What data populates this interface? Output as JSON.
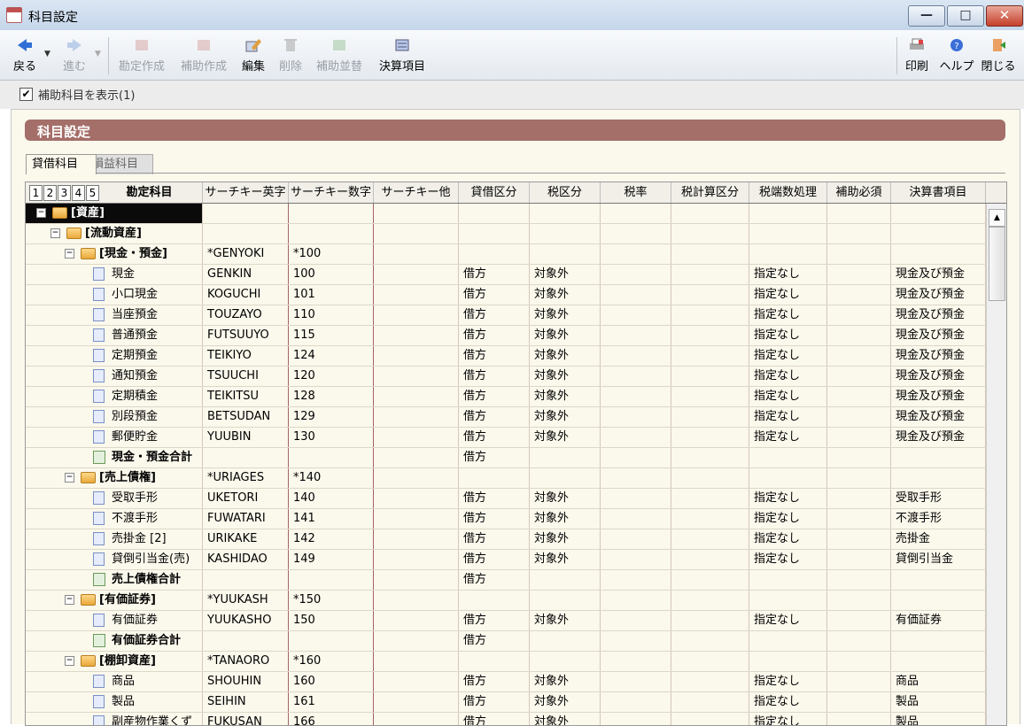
{
  "window": {
    "title": "科目設定"
  },
  "toolbar": {
    "back": "戻る",
    "forward": "進む",
    "create_account": "勘定作成",
    "create_sub": "補助作成",
    "edit": "編集",
    "delete": "削除",
    "sub_order": "補助並替",
    "settlement": "決算項目",
    "print": "印刷",
    "help": "ヘルプ",
    "close": "閉じる"
  },
  "option": {
    "show_sub_label": "補助科目を表示(1)"
  },
  "banner": {
    "title": "科目設定"
  },
  "tabs": [
    {
      "label": "貸借科目"
    },
    {
      "label": "損益科目"
    }
  ],
  "grid": {
    "levels": [
      "1",
      "2",
      "3",
      "4",
      "5"
    ],
    "headers": [
      "勘定科目",
      "サーチキー英字",
      "サーチキー数字",
      "サーチキー他",
      "貸借区分",
      "税区分",
      "税率",
      "税計算区分",
      "税端数処理",
      "補助必須",
      "決算書項目"
    ],
    "rows": [
      {
        "name": "[資産]",
        "type": "folder",
        "level": 0,
        "bold": true,
        "en": "",
        "num": "",
        "dc": "",
        "tax": "",
        "round": "",
        "item": ""
      },
      {
        "name": "[流動資産]",
        "type": "folder",
        "level": 1,
        "bold": true,
        "en": "",
        "num": "",
        "dc": "",
        "tax": "",
        "round": "",
        "item": ""
      },
      {
        "name": "[現金・預金]",
        "type": "folder",
        "level": 2,
        "bold": true,
        "en": "*GENYOKI",
        "num": "*100",
        "dc": "",
        "tax": "",
        "round": "",
        "item": ""
      },
      {
        "name": "現金",
        "type": "doc",
        "level": 3,
        "bold": false,
        "en": "GENKIN",
        "num": "100",
        "dc": "借方",
        "tax": "対象外",
        "round": "指定なし",
        "item": "現金及び預金"
      },
      {
        "name": "小口現金",
        "type": "doc",
        "level": 3,
        "bold": false,
        "en": "KOGUCHI",
        "num": "101",
        "dc": "借方",
        "tax": "対象外",
        "round": "指定なし",
        "item": "現金及び預金"
      },
      {
        "name": "当座預金",
        "type": "doc",
        "level": 3,
        "bold": false,
        "en": "TOUZAYO",
        "num": "110",
        "dc": "借方",
        "tax": "対象外",
        "round": "指定なし",
        "item": "現金及び預金"
      },
      {
        "name": "普通預金",
        "type": "doc",
        "level": 3,
        "bold": false,
        "en": "FUTSUUYO",
        "num": "115",
        "dc": "借方",
        "tax": "対象外",
        "round": "指定なし",
        "item": "現金及び預金"
      },
      {
        "name": "定期預金",
        "type": "doc",
        "level": 3,
        "bold": false,
        "en": "TEIKIYO",
        "num": "124",
        "dc": "借方",
        "tax": "対象外",
        "round": "指定なし",
        "item": "現金及び預金"
      },
      {
        "name": "通知預金",
        "type": "doc",
        "level": 3,
        "bold": false,
        "en": "TSUUCHI",
        "num": "120",
        "dc": "借方",
        "tax": "対象外",
        "round": "指定なし",
        "item": "現金及び預金"
      },
      {
        "name": "定期積金",
        "type": "doc",
        "level": 3,
        "bold": false,
        "en": "TEIKITSU",
        "num": "128",
        "dc": "借方",
        "tax": "対象外",
        "round": "指定なし",
        "item": "現金及び預金"
      },
      {
        "name": "別段預金",
        "type": "doc",
        "level": 3,
        "bold": false,
        "en": "BETSUDAN",
        "num": "129",
        "dc": "借方",
        "tax": "対象外",
        "round": "指定なし",
        "item": "現金及び預金"
      },
      {
        "name": "郵便貯金",
        "type": "doc",
        "level": 3,
        "bold": false,
        "en": "YUUBIN",
        "num": "130",
        "dc": "借方",
        "tax": "対象外",
        "round": "指定なし",
        "item": "現金及び預金"
      },
      {
        "name": "現金・預金合計",
        "type": "sum",
        "level": 3,
        "bold": true,
        "en": "",
        "num": "",
        "dc": "借方",
        "tax": "",
        "round": "",
        "item": ""
      },
      {
        "name": "[売上債権]",
        "type": "folder",
        "level": 2,
        "bold": true,
        "en": "*URIAGES",
        "num": "*140",
        "dc": "",
        "tax": "",
        "round": "",
        "item": ""
      },
      {
        "name": "受取手形",
        "type": "doc",
        "level": 3,
        "bold": false,
        "en": "UKETORI",
        "num": "140",
        "dc": "借方",
        "tax": "対象外",
        "round": "指定なし",
        "item": "受取手形"
      },
      {
        "name": "不渡手形",
        "type": "doc",
        "level": 3,
        "bold": false,
        "en": "FUWATARI",
        "num": "141",
        "dc": "借方",
        "tax": "対象外",
        "round": "指定なし",
        "item": "不渡手形"
      },
      {
        "name": "売掛金 [2]",
        "type": "doc",
        "level": 3,
        "bold": false,
        "en": "URIKAKE",
        "num": "142",
        "dc": "借方",
        "tax": "対象外",
        "round": "指定なし",
        "item": "売掛金"
      },
      {
        "name": "貸倒引当金(売)",
        "type": "doc",
        "level": 3,
        "bold": false,
        "en": "KASHIDAO",
        "num": "149",
        "dc": "借方",
        "tax": "対象外",
        "round": "指定なし",
        "item": "貸倒引当金"
      },
      {
        "name": "売上債権合計",
        "type": "sum",
        "level": 3,
        "bold": true,
        "en": "",
        "num": "",
        "dc": "借方",
        "tax": "",
        "round": "",
        "item": ""
      },
      {
        "name": "[有価証券]",
        "type": "folder",
        "level": 2,
        "bold": true,
        "en": "*YUUKASH",
        "num": "*150",
        "dc": "",
        "tax": "",
        "round": "",
        "item": ""
      },
      {
        "name": "有価証券",
        "type": "doc",
        "level": 3,
        "bold": false,
        "en": "YUUKASHO",
        "num": "150",
        "dc": "借方",
        "tax": "対象外",
        "round": "指定なし",
        "item": "有価証券"
      },
      {
        "name": "有価証券合計",
        "type": "sum",
        "level": 3,
        "bold": true,
        "en": "",
        "num": "",
        "dc": "借方",
        "tax": "",
        "round": "",
        "item": ""
      },
      {
        "name": "[棚卸資産]",
        "type": "folder",
        "level": 2,
        "bold": true,
        "en": "*TANAORO",
        "num": "*160",
        "dc": "",
        "tax": "",
        "round": "",
        "item": ""
      },
      {
        "name": "商品",
        "type": "doc",
        "level": 3,
        "bold": false,
        "en": "SHOUHIN",
        "num": "160",
        "dc": "借方",
        "tax": "対象外",
        "round": "指定なし",
        "item": "商品"
      },
      {
        "name": "製品",
        "type": "doc",
        "level": 3,
        "bold": false,
        "en": "SEIHIN",
        "num": "161",
        "dc": "借方",
        "tax": "対象外",
        "round": "指定なし",
        "item": "製品"
      },
      {
        "name": "副産物作業くず",
        "type": "doc",
        "level": 3,
        "bold": false,
        "en": "FUKUSAN",
        "num": "166",
        "dc": "借方",
        "tax": "対象外",
        "round": "指定なし",
        "item": "製品"
      }
    ]
  }
}
